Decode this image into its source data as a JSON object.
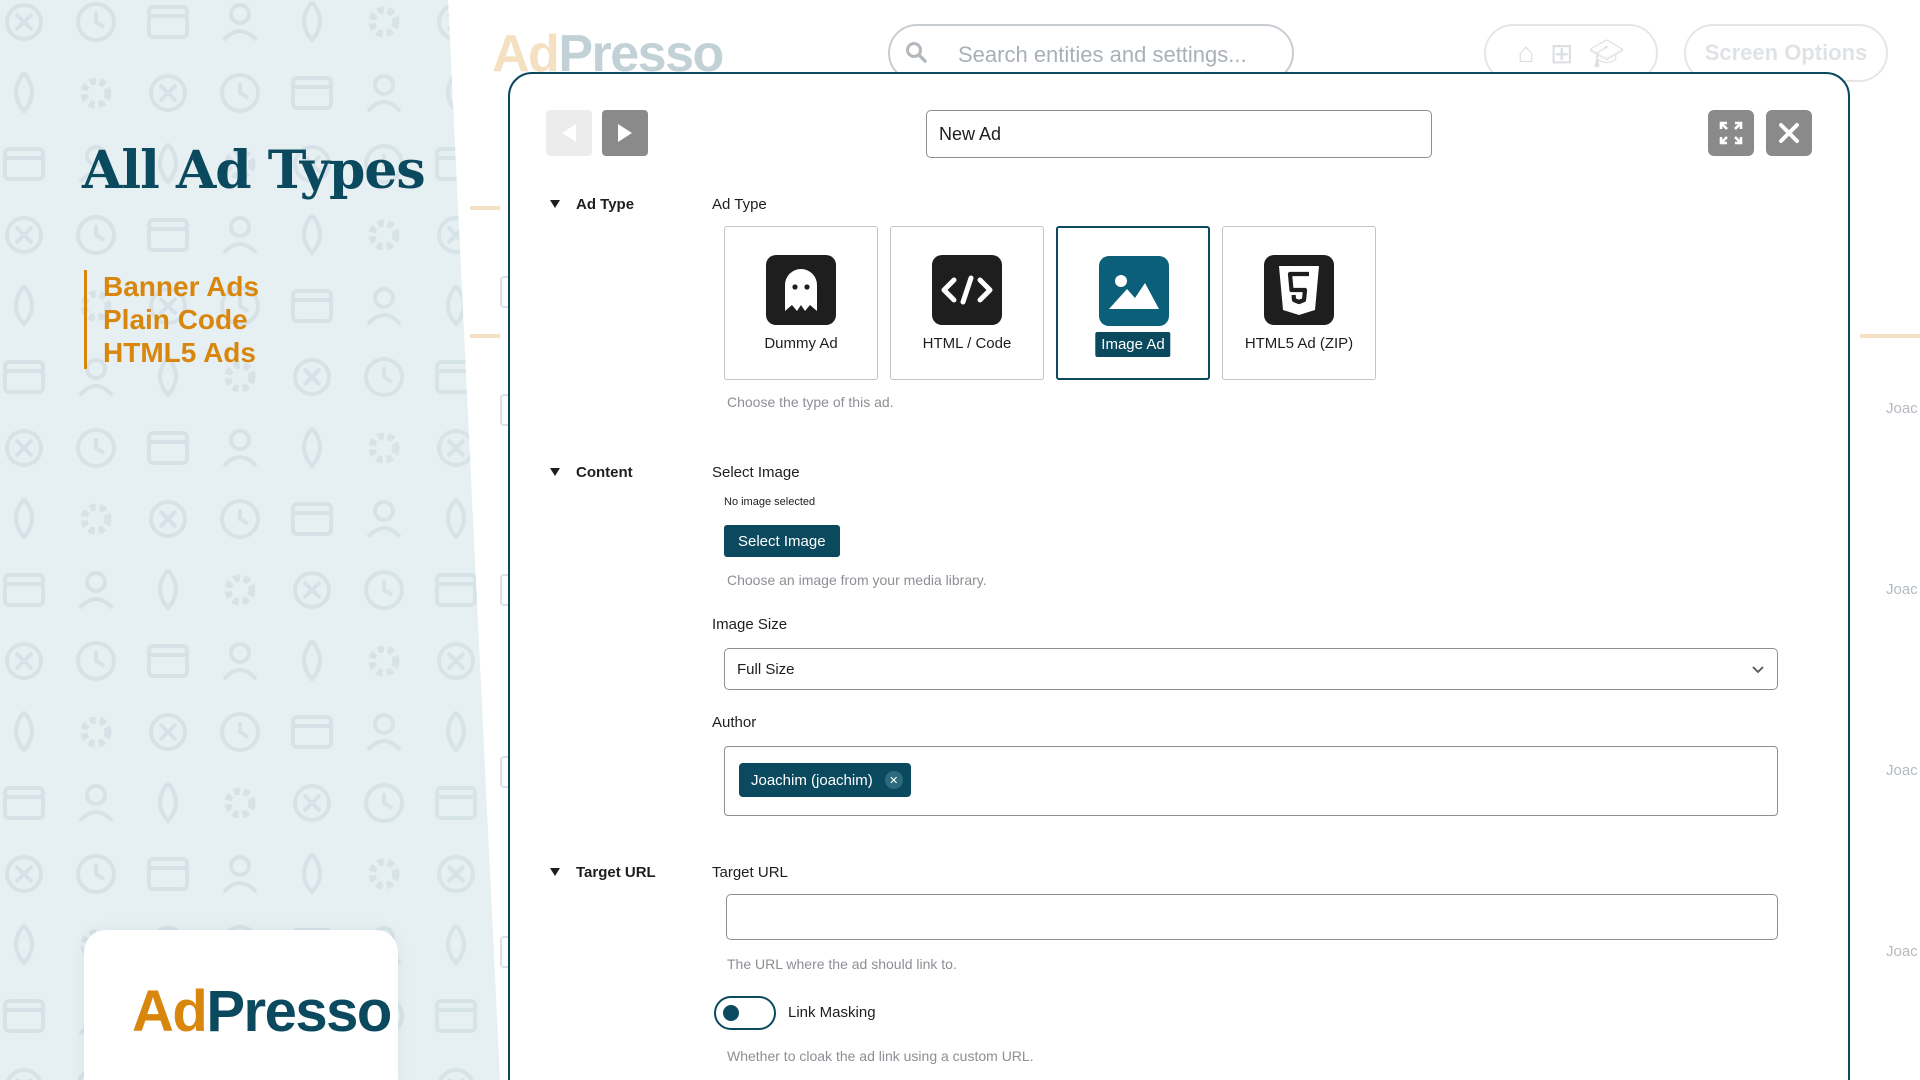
{
  "promo": {
    "title": "All Ad Types",
    "features": [
      "Banner Ads",
      "Plain Code",
      "HTML5 Ads"
    ],
    "logo": {
      "ad": "Ad",
      "presso": "Presso"
    }
  },
  "background_app": {
    "logo": {
      "ad": "Ad",
      "presso": "Presso"
    },
    "search_placeholder": "Search entities and settings...",
    "screen_options_label": "Screen Options",
    "author_column_text": "Joac"
  },
  "modal": {
    "title_value": "New Ad",
    "sections": {
      "ad_type": "Ad Type",
      "content": "Content",
      "target_url": "Target URL"
    },
    "ad_type": {
      "label": "Ad Type",
      "options": [
        {
          "label": "Dummy Ad",
          "icon": "ghost-icon",
          "selected": false
        },
        {
          "label": "HTML / Code",
          "icon": "code-icon",
          "selected": false
        },
        {
          "label": "Image Ad",
          "icon": "image-icon",
          "selected": true
        },
        {
          "label": "HTML5 Ad (ZIP)",
          "icon": "html5-icon",
          "selected": false
        }
      ],
      "help": "Choose the type of this ad."
    },
    "content": {
      "select_image_label": "Select Image",
      "no_image_text": "No image selected",
      "select_image_button": "Select Image",
      "select_image_help": "Choose an image from your media library.",
      "image_size_label": "Image Size",
      "image_size_value": "Full Size",
      "author_label": "Author",
      "author_value": "Joachim (joachim)"
    },
    "target": {
      "label": "Target URL",
      "value": "",
      "help": "The URL where the ad should link to.",
      "link_masking_label": "Link Masking",
      "link_masking_on": true,
      "link_masking_help": "Whether to cloak the ad link using a custom URL."
    }
  },
  "colors": {
    "brand_teal": "#0b4a5e",
    "brand_orange": "#d9860d",
    "promo_bg": "#e6eff2"
  }
}
